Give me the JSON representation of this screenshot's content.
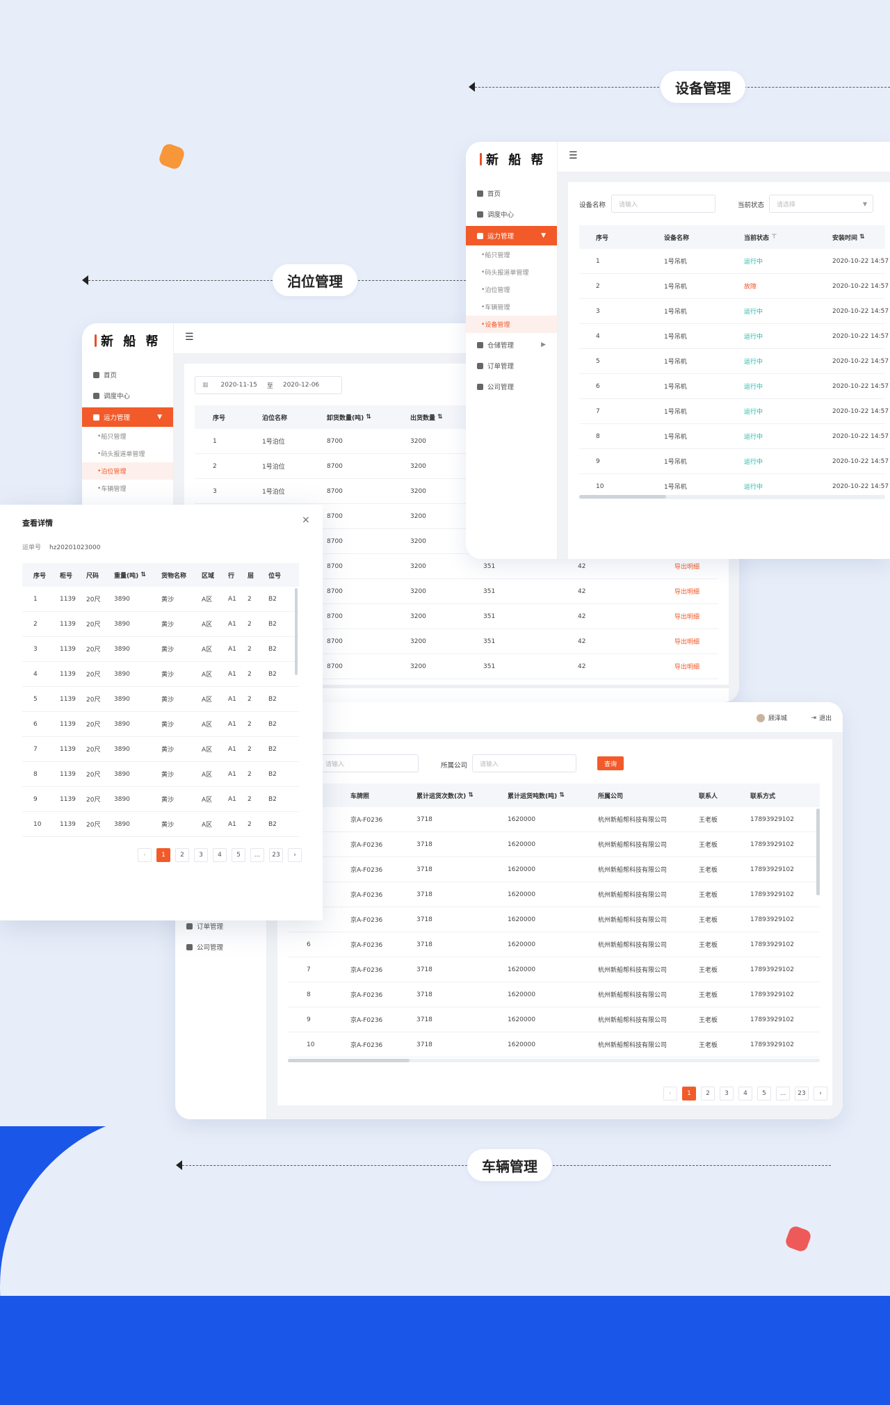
{
  "colors": {
    "accent": "#f25a29",
    "running": "#1bb7a6",
    "background": "#e8eef9",
    "brand_blue": "#1a56e8",
    "blob_orange": "#f8963a",
    "blob_red": "#ee5a5a"
  },
  "labels": {
    "equipment": "设备管理",
    "berth": "泊位管理",
    "vehicle": "车辆管理"
  },
  "brand": "新 船 帮",
  "sidebar": {
    "items": [
      {
        "label": "首页",
        "icon": "home-icon"
      },
      {
        "label": "调度中心",
        "icon": "schedule-icon"
      },
      {
        "label": "运力管理",
        "icon": "grid-icon"
      },
      {
        "label": "仓储管理",
        "icon": "box-icon"
      },
      {
        "label": "订单管理",
        "icon": "order-icon"
      },
      {
        "label": "公司管理",
        "icon": "company-icon"
      }
    ],
    "subs": [
      "船只管理",
      "码头报道单管理",
      "泊位管理",
      "车辆管理",
      "设备管理"
    ]
  },
  "equipment": {
    "filter_name_label": "设备名称",
    "filter_name_placeholder": "请输入",
    "filter_state_label": "当前状态",
    "filter_state_placeholder": "请选择",
    "columns": [
      "序号",
      "设备名称",
      "当前状态",
      "安装时间"
    ],
    "rows": [
      [
        "1",
        "1号吊机",
        "运行中",
        "2020-10-22 14:57"
      ],
      [
        "2",
        "1号吊机",
        "故障",
        "2020-10-22 14:57"
      ],
      [
        "3",
        "1号吊机",
        "运行中",
        "2020-10-22 14:57"
      ],
      [
        "4",
        "1号吊机",
        "运行中",
        "2020-10-22 14:57"
      ],
      [
        "5",
        "1号吊机",
        "运行中",
        "2020-10-22 14:57"
      ],
      [
        "6",
        "1号吊机",
        "运行中",
        "2020-10-22 14:57"
      ],
      [
        "7",
        "1号吊机",
        "运行中",
        "2020-10-22 14:57"
      ],
      [
        "8",
        "1号吊机",
        "运行中",
        "2020-10-22 14:57"
      ],
      [
        "9",
        "1号吊机",
        "运行中",
        "2020-10-22 14:57"
      ],
      [
        "10",
        "1号吊机",
        "运行中",
        "2020-10-22 14:57"
      ]
    ]
  },
  "berth": {
    "date_from": "2020-11-15",
    "date_sep": "至",
    "date_to": "2020-12-06",
    "columns": [
      "序号",
      "泊位名称",
      "卸货数量(吨)",
      "出货数量"
    ],
    "rows": [
      [
        "1",
        "1号泊位",
        "8700",
        "3200"
      ],
      [
        "2",
        "1号泊位",
        "8700",
        "3200"
      ],
      [
        "3",
        "1号泊位",
        "8700",
        "3200"
      ]
    ],
    "extra_rows": [
      [
        "8700",
        "3200",
        "",
        ""
      ],
      [
        "8700",
        "3200",
        "",
        ""
      ],
      [
        "8700",
        "3200",
        "351",
        "42"
      ],
      [
        "8700",
        "3200",
        "351",
        "42"
      ],
      [
        "8700",
        "3200",
        "351",
        "42"
      ],
      [
        "8700",
        "3200",
        "351",
        "42"
      ],
      [
        "8700",
        "3200",
        "351",
        "42"
      ]
    ],
    "export_label": "导出明细"
  },
  "vehicle": {
    "user": "顾泽城",
    "logout": "退出",
    "filter_placeholder": "请输入",
    "company_label": "所属公司",
    "company_placeholder": "请输入",
    "query": "查询",
    "columns": [
      "车牌照",
      "累计运货次数(次)",
      "累计运货吨数(吨)",
      "所属公司",
      "联系人",
      "联系方式"
    ],
    "rows": [
      [
        "",
        "京A-F0236",
        "3718",
        "1620000",
        "杭州新船帮科技有限公司",
        "王老板",
        "17893929102"
      ],
      [
        "",
        "京A-F0236",
        "3718",
        "1620000",
        "杭州新船帮科技有限公司",
        "王老板",
        "17893929102"
      ],
      [
        "",
        "京A-F0236",
        "3718",
        "1620000",
        "杭州新船帮科技有限公司",
        "王老板",
        "17893929102"
      ],
      [
        "",
        "京A-F0236",
        "3718",
        "1620000",
        "杭州新船帮科技有限公司",
        "王老板",
        "17893929102"
      ],
      [
        "",
        "京A-F0236",
        "3718",
        "1620000",
        "杭州新船帮科技有限公司",
        "王老板",
        "17893929102"
      ],
      [
        "6",
        "京A-F0236",
        "3718",
        "1620000",
        "杭州新船帮科技有限公司",
        "王老板",
        "17893929102"
      ],
      [
        "7",
        "京A-F0236",
        "3718",
        "1620000",
        "杭州新船帮科技有限公司",
        "王老板",
        "17893929102"
      ],
      [
        "8",
        "京A-F0236",
        "3718",
        "1620000",
        "杭州新船帮科技有限公司",
        "王老板",
        "17893929102"
      ],
      [
        "9",
        "京A-F0236",
        "3718",
        "1620000",
        "杭州新船帮科技有限公司",
        "王老板",
        "17893929102"
      ],
      [
        "10",
        "京A-F0236",
        "3718",
        "1620000",
        "杭州新船帮科技有限公司",
        "王老板",
        "17893929102"
      ]
    ],
    "side_items": [
      "订单管理",
      "公司管理"
    ],
    "pages": [
      "1",
      "2",
      "3",
      "4",
      "5",
      "...",
      "23"
    ]
  },
  "modal": {
    "title": "查看详情",
    "order_label": "运单号",
    "order_no": "hz20201023000",
    "columns": [
      "序号",
      "柜号",
      "尺码",
      "重量(吨)",
      "货物名称",
      "区域",
      "行",
      "层",
      "位号"
    ],
    "rows": [
      [
        "1",
        "1139",
        "20尺",
        "3890",
        "黄沙",
        "A区",
        "A1",
        "2",
        "B2"
      ],
      [
        "2",
        "1139",
        "20尺",
        "3890",
        "黄沙",
        "A区",
        "A1",
        "2",
        "B2"
      ],
      [
        "3",
        "1139",
        "20尺",
        "3890",
        "黄沙",
        "A区",
        "A1",
        "2",
        "B2"
      ],
      [
        "4",
        "1139",
        "20尺",
        "3890",
        "黄沙",
        "A区",
        "A1",
        "2",
        "B2"
      ],
      [
        "5",
        "1139",
        "20尺",
        "3890",
        "黄沙",
        "A区",
        "A1",
        "2",
        "B2"
      ],
      [
        "6",
        "1139",
        "20尺",
        "3890",
        "黄沙",
        "A区",
        "A1",
        "2",
        "B2"
      ],
      [
        "7",
        "1139",
        "20尺",
        "3890",
        "黄沙",
        "A区",
        "A1",
        "2",
        "B2"
      ],
      [
        "8",
        "1139",
        "20尺",
        "3890",
        "黄沙",
        "A区",
        "A1",
        "2",
        "B2"
      ],
      [
        "9",
        "1139",
        "20尺",
        "3890",
        "黄沙",
        "A区",
        "A1",
        "2",
        "B2"
      ],
      [
        "10",
        "1139",
        "20尺",
        "3890",
        "黄沙",
        "A区",
        "A1",
        "2",
        "B2"
      ]
    ],
    "pages": [
      "1",
      "2",
      "3",
      "4",
      "5",
      "...",
      "23"
    ]
  }
}
